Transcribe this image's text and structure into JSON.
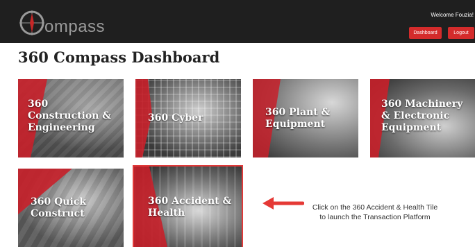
{
  "header": {
    "logo_text": "ompass",
    "welcome": "Welcome Fouzia!",
    "dashboard_label": "Dashboard",
    "logout_label": "Logout",
    "colors": {
      "bar": "#1f1f1f",
      "button": "#d42b2b"
    }
  },
  "page": {
    "title": "360 Compass Dashboard"
  },
  "tiles": [
    {
      "label": "360\nConstruction &\nEngineering"
    },
    {
      "label": "360 Cyber"
    },
    {
      "label": "360 Plant &\nEquipment"
    },
    {
      "label": "360 Machinery\n& Electronic\nEquipment"
    },
    {
      "label": "360 Quick\nConstruct"
    },
    {
      "label": "360 Accident &\nHealth"
    }
  ],
  "annotation": {
    "text": "Click on the 360 Accident & Health Tile\nto launch the Transaction Platform",
    "arrow_icon": "left-arrow-icon"
  }
}
